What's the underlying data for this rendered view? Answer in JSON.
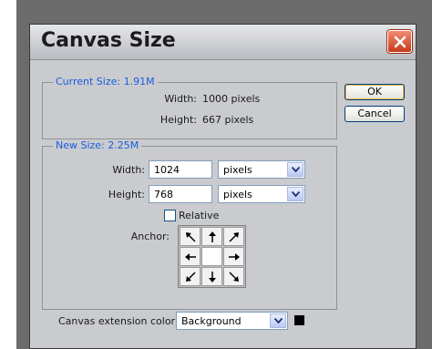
{
  "dialog": {
    "title": "Canvas Size",
    "close_icon": "close-icon"
  },
  "current_size": {
    "legend": "Current Size: 1.91M",
    "width_label": "Width:",
    "width_value": "1000 pixels",
    "height_label": "Height:",
    "height_value": "667 pixels"
  },
  "new_size": {
    "legend": "New Size: 2.25M",
    "width_label": "Width:",
    "width_value": "1024",
    "width_unit": "pixels",
    "height_label": "Height:",
    "height_value": "768",
    "height_unit": "pixels",
    "relative_label": "Relative",
    "relative_checked": false,
    "anchor_label": "Anchor:",
    "anchor_selected": "center",
    "anchor_arrows": [
      "arrow-up-left",
      "arrow-up",
      "arrow-up-right",
      "arrow-left",
      "center",
      "arrow-right",
      "arrow-down-left",
      "arrow-down",
      "arrow-down-right"
    ]
  },
  "extension": {
    "label": "Canvas extension color:",
    "value": "Background",
    "swatch_color": "#000000"
  },
  "buttons": {
    "ok": "OK",
    "cancel": "Cancel"
  },
  "colors": {
    "legend_text": "#1a5ce0",
    "dialog_bg": "#c9cbcf",
    "close_button": "#d9492a"
  }
}
